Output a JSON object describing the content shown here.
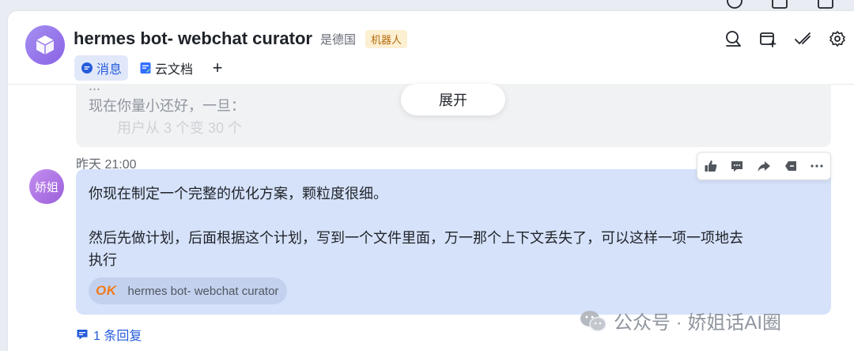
{
  "header": {
    "title": "hermes bot- webchat curator",
    "owner": "是德国",
    "badge": "机器人",
    "tabs": [
      {
        "label": "消息",
        "icon": "message-icon",
        "active": true
      },
      {
        "label": "云文档",
        "icon": "doc-icon",
        "active": false
      }
    ],
    "add_tab": "+",
    "toolbar": [
      "search-icon",
      "add-member-icon",
      "done-icon",
      "settings-icon"
    ]
  },
  "collapsed": {
    "lines": [
      "...",
      "现在你量小还好，一旦：",
      "　　用户从 3 个变 30 个"
    ],
    "expand_label": "展开"
  },
  "message": {
    "time": "昨天 21:00",
    "sender_avatar": "娇姐",
    "paragraph1": "你现在制定一个完整的优化方案，颗粒度很细。",
    "paragraph2_line1": "然后先做计划，后面根据这个计划，写到一个文件里面，万一那个上下文丢失了，可以这样一项一项地去",
    "paragraph2_line2": "执行",
    "bot_chip": {
      "logo": "OK",
      "label": "hermes bot- webchat curator"
    },
    "actions": [
      "thumbs-up-icon",
      "comment-icon",
      "forward-icon",
      "pin-icon",
      "more-icon"
    ],
    "reply_label": "1 条回复"
  },
  "watermark": "公众号 · 娇姐话AI圈",
  "colors": {
    "accent": "#245bdb",
    "bubble": "#d6e2fa",
    "badge_bg": "#fcefd2",
    "badge_fg": "#b36a0b",
    "ok_logo": "#f07b1a"
  }
}
